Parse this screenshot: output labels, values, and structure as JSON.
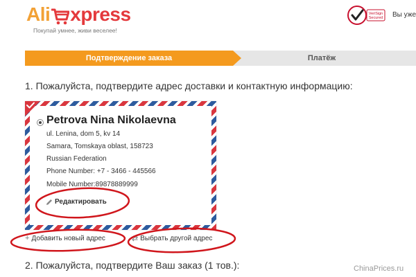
{
  "header": {
    "logo_left": "Ali",
    "logo_right": "xpress",
    "tagline": "Покупай умнее, живи веселее!",
    "seal_line1": "VeriSign",
    "seal_line2": "Secured",
    "user_text": "Вы уже"
  },
  "progress": {
    "steps": [
      {
        "label": "Подтверждение заказа",
        "active": true
      },
      {
        "label": "Платёж",
        "active": false
      }
    ]
  },
  "section1": {
    "heading": "1. Пожалуйста, подтвердите адрес доставки и контактную информацию:"
  },
  "address_card": {
    "name": "Petrova Nina Nikolaevna",
    "lines": [
      "ul. Lenina, dom 5, kv 14",
      "Samara, Tomskaya oblast, 158723",
      "Russian Federation",
      "Phone Number: +7 - 3466 - 445566",
      "Mobile Number:89878889999"
    ],
    "edit_label": "Редактировать"
  },
  "address_actions": {
    "add_label": "Добавить новый адрес",
    "choose_label": "Выбрать другой адрес"
  },
  "section2": {
    "heading": "2. Пожалуйста, подтвердите Ваш заказ (1 тов.):"
  },
  "watermark": "ChinaPrices.ru",
  "colors": {
    "accent_orange": "#f49a1e",
    "logo_orange": "#f2a136",
    "logo_red": "#e4393c",
    "annotation_red": "#d0161c",
    "airmail_red": "#d9363e",
    "airmail_blue": "#2d5b9e"
  }
}
